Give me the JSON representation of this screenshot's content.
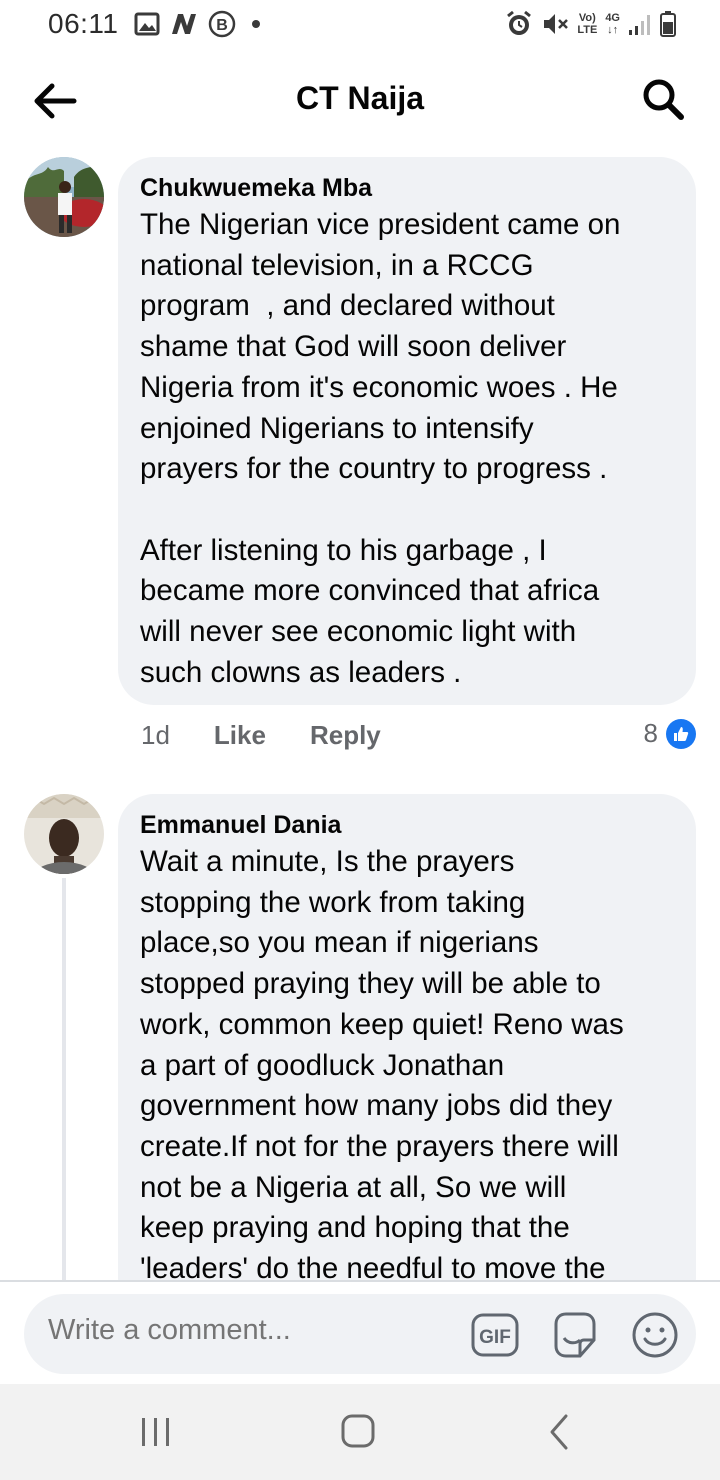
{
  "status_bar": {
    "time": "06:11",
    "network_top": "Vo)",
    "network_bottom": "LTE",
    "data_top": "4G",
    "data_bottom": "↓↑",
    "left_icons": [
      "image-icon",
      "n-icon",
      "b-icon",
      "dot-icon"
    ],
    "right_icons": [
      "alarm-icon",
      "mute-icon",
      "volte-icon",
      "4g-icon",
      "signal-icon",
      "battery-icon"
    ]
  },
  "header": {
    "title": "CT Naija",
    "back_icon": "arrow-left-icon",
    "search_icon": "search-icon"
  },
  "comments": [
    {
      "author": "Chukwuemeka Mba",
      "text": "The Nigerian vice president came on\nnational television, in a RCCG\nprogram  , and declared without\nshame that God will soon deliver\nNigeria from it's economic woes . He\nenjoined Nigerians to intensify\nprayers for the country to progress .\n\nAfter listening to his garbage , I\nbecame more convinced that africa\nwill never see economic light with\nsuch clowns as leaders .",
      "time": "1d",
      "like_label": "Like",
      "reply_label": "Reply",
      "reaction_count": "8"
    },
    {
      "author": "Emmanuel Dania",
      "text": "Wait a minute, Is the prayers\nstopping the work from taking\nplace,so you mean if nigerians\nstopped praying they will be able to\nwork, common keep quiet! Reno was\na part of goodluck Jonathan\ngovernment how many jobs did they\ncreate.If not for the prayers there will\nnot be a Nigeria at all, So we will\nkeep praying and hoping that the\n'leaders' do the needful to move the"
    }
  ],
  "composer": {
    "placeholder": "Write a comment...",
    "gif_label": "GIF",
    "icons": [
      "gif-icon",
      "sticker-icon",
      "emoji-icon"
    ]
  },
  "nav_bar": {
    "icons": [
      "recent-apps-icon",
      "home-icon",
      "back-icon"
    ]
  },
  "colors": {
    "bubble": "#f0f2f5",
    "meta_text": "#65676b",
    "like_blue": "#1877f2"
  }
}
